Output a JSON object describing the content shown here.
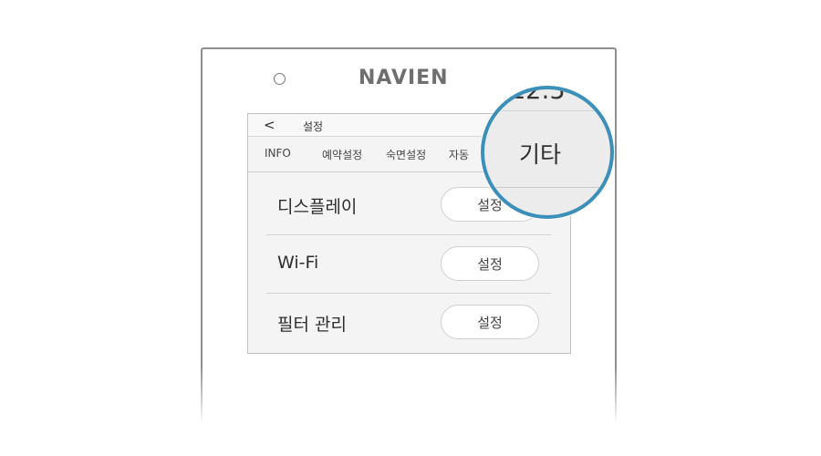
{
  "brand": {
    "logo_text": "NAVIEN"
  },
  "icons": {
    "power": "power-button-icon",
    "back": "chevron-left-icon"
  },
  "header": {
    "back_glyph": "<",
    "title": "설정"
  },
  "tabs": [
    {
      "label": "INFO"
    },
    {
      "label": "예약설정"
    },
    {
      "label": "숙면설정"
    },
    {
      "label": "자동"
    }
  ],
  "settings": [
    {
      "label": "디스플레이",
      "button": "설정"
    },
    {
      "label": "Wi-Fi",
      "button": "설정"
    },
    {
      "label": "필터 관리",
      "button": "설정"
    }
  ],
  "magnifier": {
    "clock_text": "12:5",
    "tab_label": "기타"
  },
  "colors": {
    "accent_ring": "#3b8fb9",
    "screen_bg": "#f4f4f4",
    "device_border": "#8d8d8d"
  }
}
